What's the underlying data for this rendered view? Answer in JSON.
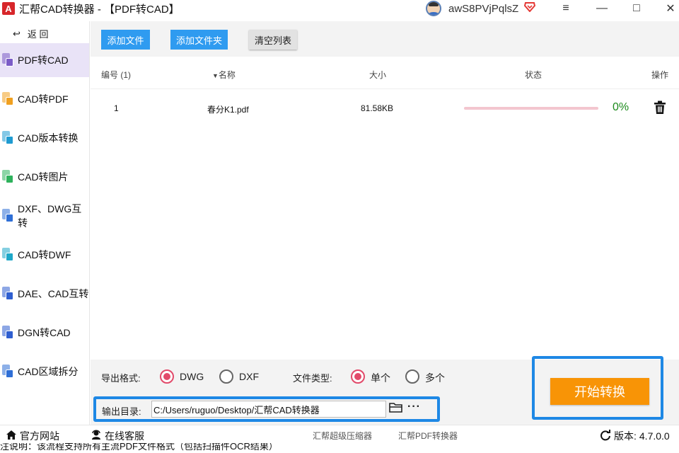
{
  "window": {
    "title": "汇帮CAD转换器 - 【PDF转CAD】",
    "logo_letter": "A",
    "username": "awS8PVjPqlsZ",
    "vip_icon": "diamond-vip-icon",
    "controls": {
      "menu": "≡",
      "minimize": "—",
      "maximize": "□",
      "close": "✕"
    }
  },
  "sidebar": {
    "back_label": "返 回",
    "back_icon": "↩",
    "items": [
      {
        "label": "PDF转CAD",
        "active": true,
        "color": "#7b5cc7"
      },
      {
        "label": "CAD转PDF",
        "active": false,
        "color": "#f0a020"
      },
      {
        "label": "CAD版本转换",
        "active": false,
        "color": "#1f9bd1"
      },
      {
        "label": "CAD转图片",
        "active": false,
        "color": "#2eb25c"
      },
      {
        "label": "DXF、DWG互转",
        "active": false,
        "color": "#2f6fd6"
      },
      {
        "label": "CAD转DWF",
        "active": false,
        "color": "#1fa8c9"
      },
      {
        "label": "DAE、CAD互转",
        "active": false,
        "color": "#2f5fd0"
      },
      {
        "label": "DGN转CAD",
        "active": false,
        "color": "#2f5fd0"
      },
      {
        "label": "CAD区域拆分",
        "active": false,
        "color": "#2f6fd6"
      }
    ]
  },
  "toolbar": {
    "add_file": "添加文件",
    "add_folder": "添加文件夹",
    "clear_list": "清空列表"
  },
  "table": {
    "headers": {
      "index": "编号 (1)",
      "name": "名称",
      "size": "大小",
      "status": "状态",
      "action": "操作"
    },
    "rows": [
      {
        "index": "1",
        "name": "春分K1.pdf",
        "size": "81.58KB",
        "progress": 0,
        "percent": "0%"
      }
    ]
  },
  "options": {
    "format_label": "导出格式:",
    "format_dwg": "DWG",
    "format_dxf": "DXF",
    "format_selected": "DWG",
    "filetype_label": "文件类型:",
    "filetype_single": "单个",
    "filetype_multi": "多个",
    "filetype_selected": "单个",
    "output_label": "输出目录:",
    "output_path": "C:/Users/ruguo/Desktop/汇帮CAD转换器",
    "more_label": "···"
  },
  "start_button": "开始转换",
  "footer": {
    "website": "官方网站",
    "support": "在线客服",
    "link1": "汇帮超级压缩器",
    "link2": "汇帮PDF转换器",
    "version_label": "版本:",
    "version": "4.7.0.0"
  },
  "note_text": "注说明：该流程支持所有主流PDF文件格式（包括扫描件OCR结果）",
  "colors": {
    "accent_blue": "#2f9bf0",
    "highlight_border": "#1e88e5",
    "start_orange": "#f89406",
    "radio_pink": "#e24a6a",
    "active_nav_bg": "#e9e3f7"
  }
}
